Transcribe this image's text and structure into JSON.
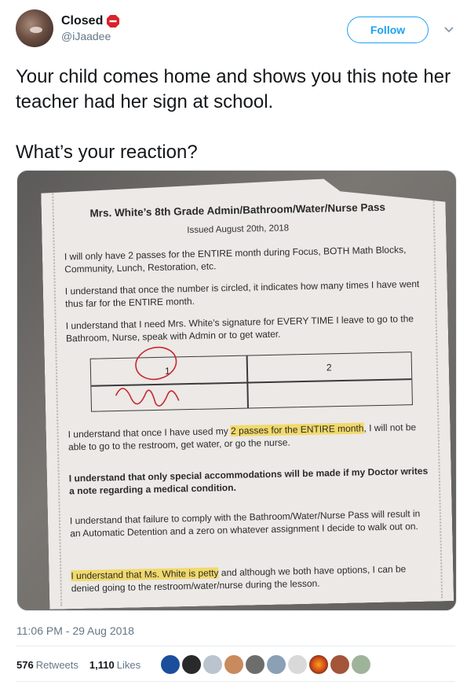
{
  "user": {
    "display_name": "Closed",
    "badge_icon": "stop-sign-icon",
    "handle": "@iJaadee",
    "follow_label": "Follow"
  },
  "tweet": {
    "text": "Your child comes home and shows you this note her teacher had her sign at school.\n\nWhat’s your reaction?"
  },
  "note": {
    "title": "Mrs. White’s 8th Grade Admin/Bathroom/Water/Nurse Pass",
    "issued": "Issued August 20th, 2018",
    "para1": "I will only have 2 passes for the ENTIRE month during Focus, BOTH Math Blocks, Community, Lunch, Restoration, etc.",
    "para2": "I understand that once the number is circled, it indicates how many times I have went thus far for the ENTIRE month.",
    "para3": "I understand that I need Mrs. White’s signature for EVERY TIME I leave to go to the Bathroom, Nurse, speak with Admin or to get water.",
    "pass_1": "1",
    "pass_2": "2",
    "para4_pre": "I understand that once I have used my ",
    "para4_hl": "2 passes for the ENTIRE month",
    "para4_post": ", I will not be able to go to the restroom, get water, or go the nurse.",
    "para5": "I understand that only special accommodations will be made if my Doctor writes a note regarding a medical condition.",
    "para6": "I understand that failure to comply with the Bathroom/Water/Nurse Pass will result in an Automatic Detention and a zero on whatever assignment I decide to walk out on.",
    "para7_hl": "I understand that Ms. White is petty",
    "para7_post": " and although we both have options, I can be denied going to the restroom/water/nurse during the lesson."
  },
  "meta": {
    "timestamp": "11:06 PM - 29 Aug 2018",
    "retweets_count": "576",
    "retweets_label": "Retweets",
    "likes_count": "1,110",
    "likes_label": "Likes"
  },
  "colors": {
    "accent": "#1da1f2",
    "muted": "#657786",
    "highlight": "#f2d96b"
  }
}
